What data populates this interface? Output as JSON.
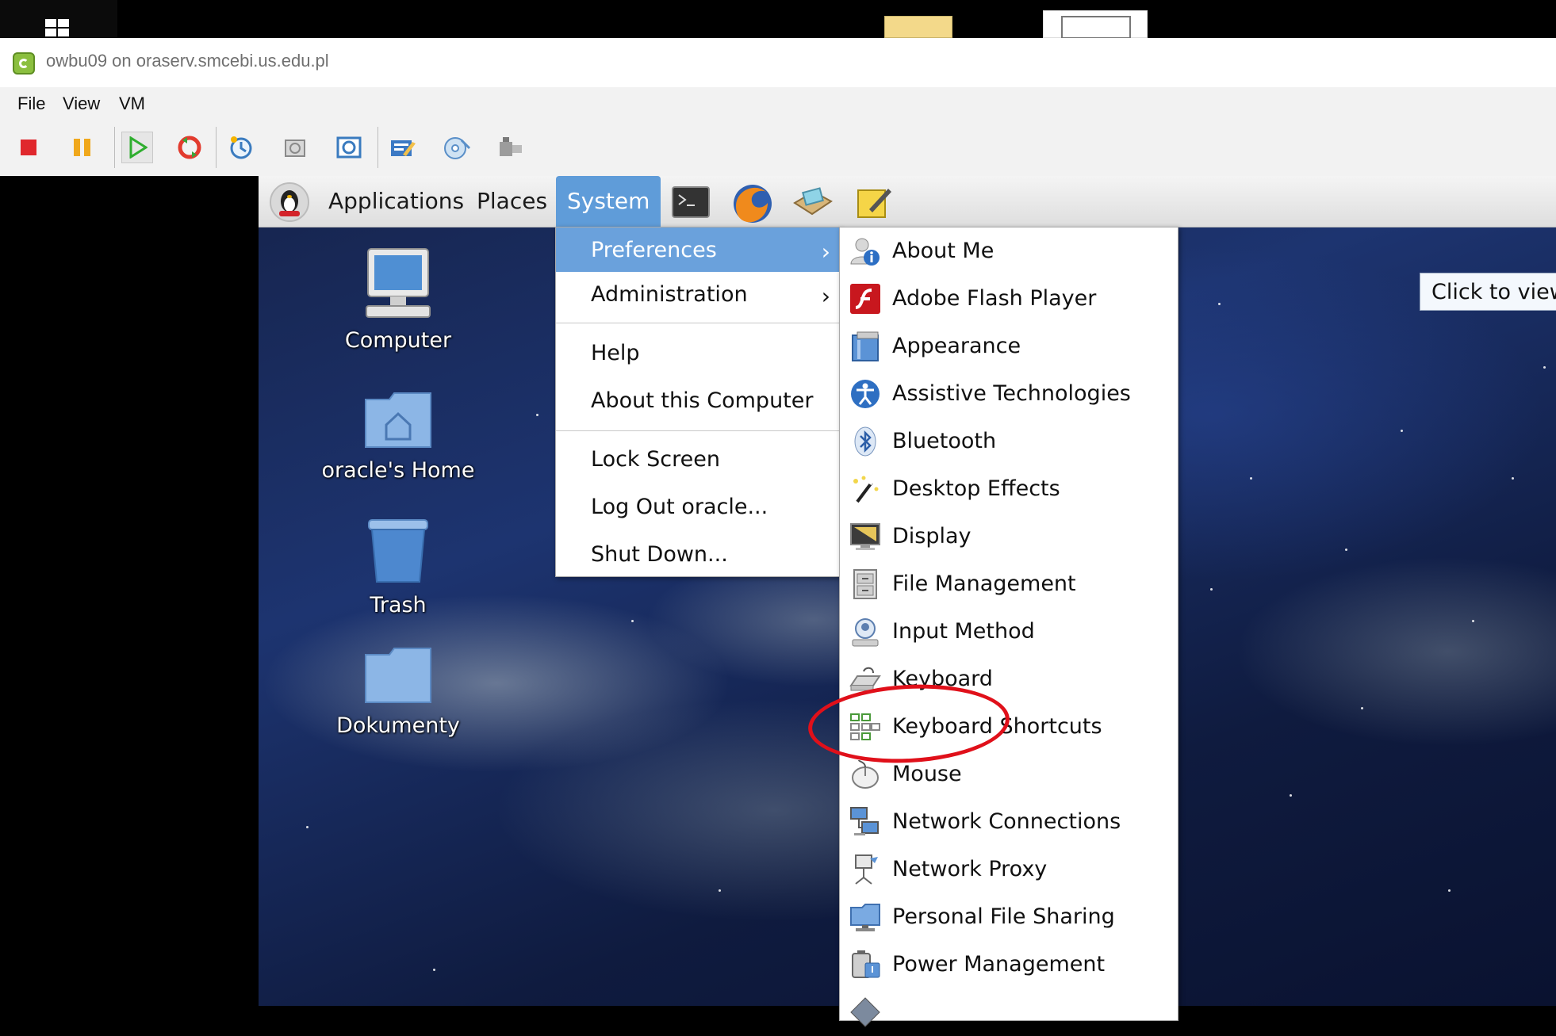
{
  "window": {
    "title": "owbu09 on oraserv.smcebi.us.edu.pl"
  },
  "menubar": {
    "file": "File",
    "view": "View",
    "vm": "VM"
  },
  "toolbar": {
    "icons": [
      "power-off-icon",
      "suspend-icon",
      "power-on-icon",
      "reset-icon",
      "snapshot-icon",
      "revert-snapshot-icon",
      "snapshot-manager-icon",
      "edit-settings-icon",
      "connect-cd-icon",
      "connect-usb-icon"
    ]
  },
  "panel": {
    "applications": "Applications",
    "places": "Places",
    "system": "System"
  },
  "desktop": {
    "computer": "Computer",
    "home": "oracle's Home",
    "trash": "Trash",
    "dokumenty": "Dokumenty"
  },
  "system_menu": {
    "preferences": "Preferences",
    "administration": "Administration",
    "help": "Help",
    "about_computer": "About this Computer",
    "lock_screen": "Lock Screen",
    "log_out": "Log Out oracle...",
    "shut_down": "Shut Down..."
  },
  "preferences_menu": {
    "items": [
      {
        "label": "About Me"
      },
      {
        "label": "Adobe Flash Player"
      },
      {
        "label": "Appearance"
      },
      {
        "label": "Assistive Technologies"
      },
      {
        "label": "Bluetooth"
      },
      {
        "label": "Desktop Effects"
      },
      {
        "label": "Display"
      },
      {
        "label": "File Management"
      },
      {
        "label": "Input Method"
      },
      {
        "label": "Keyboard"
      },
      {
        "label": "Keyboard Shortcuts"
      },
      {
        "label": "Mouse"
      },
      {
        "label": "Network Connections"
      },
      {
        "label": "Network Proxy"
      },
      {
        "label": "Personal File Sharing"
      },
      {
        "label": "Power Management"
      }
    ]
  },
  "tooltip": {
    "text": "Click to view"
  },
  "colors": {
    "selection": "#6aa1dc",
    "annotation_ring": "#e0101a"
  }
}
